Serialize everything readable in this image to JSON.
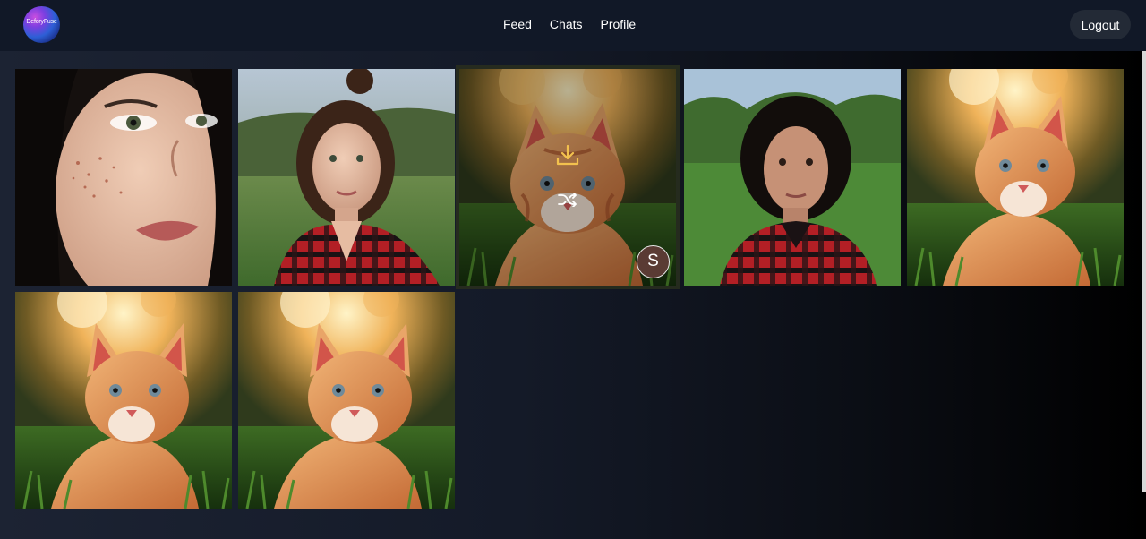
{
  "header": {
    "logo_text": "DeforyFuse",
    "nav": {
      "feed": "Feed",
      "chats": "Chats",
      "profile": "Profile"
    },
    "logout_label": "Logout"
  },
  "gallery": {
    "items": [
      {
        "subject": "woman-closeup-freckles"
      },
      {
        "subject": "woman-plaid-shirt"
      },
      {
        "subject": "cat-in-grass",
        "active": true,
        "owner_initial": "S"
      },
      {
        "subject": "woman-curly-hair"
      },
      {
        "subject": "cat-in-grass"
      },
      {
        "subject": "cat-in-grass"
      },
      {
        "subject": "cat-in-grass"
      }
    ]
  },
  "colors": {
    "header_bg": "#111827",
    "logout_bg": "#232a36",
    "download_icon": "#f2c14e",
    "avatar_bg": "#5a3b34"
  },
  "icons": [
    "download-icon",
    "shuffle-icon"
  ]
}
